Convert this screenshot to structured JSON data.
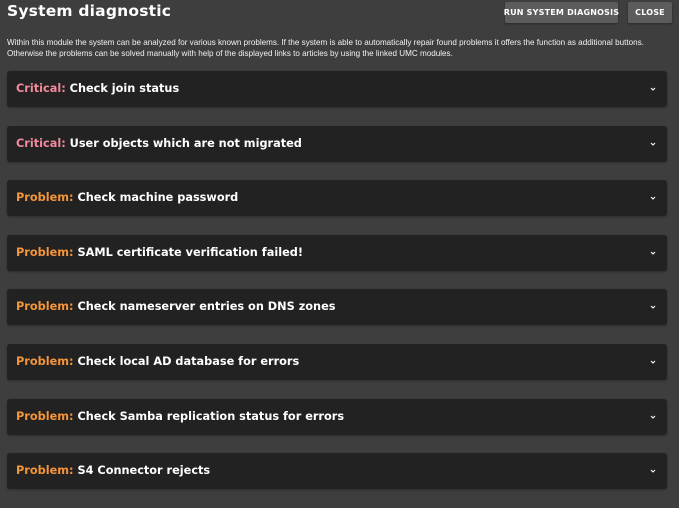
{
  "header": {
    "title": "System diagnostic",
    "run_button_label": "RUN SYSTEM DIAGNOSIS",
    "close_button_label": "CLOSE"
  },
  "description": "Within this module the system can be analyzed for various known problems. If the system is able to automatically repair found problems it offers the function as additional buttons. Otherwise the problems can be solved manually with help of the displayed links to articles by using the linked UMC modules.",
  "colors": {
    "critical": "#f28a9b",
    "problem": "#f5953a"
  },
  "problems": [
    {
      "severity": "Critical:",
      "title": "Check join status",
      "icon": "chevron-down-icon"
    },
    {
      "severity": "Critical:",
      "title": "User objects which are not migrated",
      "icon": "chevron-down-icon"
    },
    {
      "severity": "Problem:",
      "title": "Check machine password",
      "icon": "chevron-down-icon"
    },
    {
      "severity": "Problem:",
      "title": "SAML certificate verification failed!",
      "icon": "chevron-down-icon"
    },
    {
      "severity": "Problem:",
      "title": "Check nameserver entries on DNS zones",
      "icon": "chevron-down-icon"
    },
    {
      "severity": "Problem:",
      "title": "Check local AD database for errors",
      "icon": "chevron-down-icon"
    },
    {
      "severity": "Problem:",
      "title": "Check Samba replication status for errors",
      "icon": "chevron-down-icon"
    },
    {
      "severity": "Problem:",
      "title": "S4 Connector rejects",
      "icon": "chevron-down-icon"
    }
  ]
}
